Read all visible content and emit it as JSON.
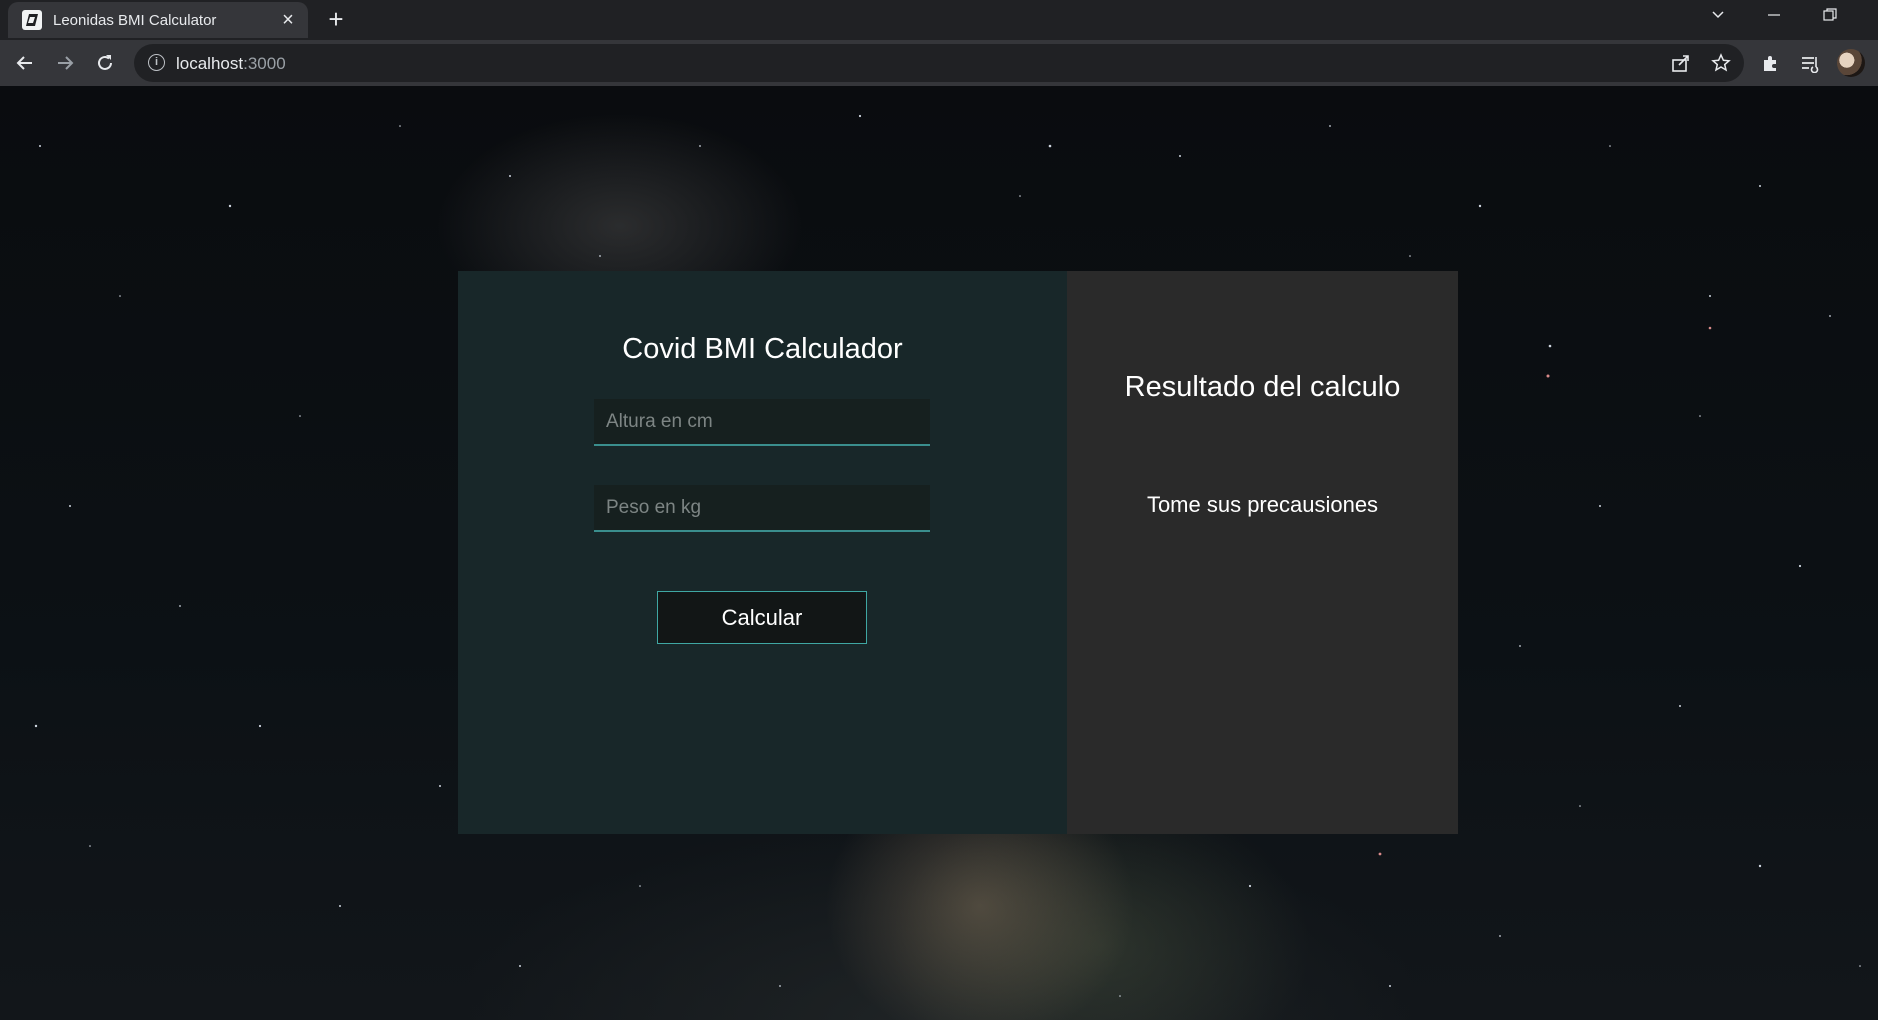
{
  "browser": {
    "tab": {
      "title": "Leonidas BMI Calculator",
      "favicon": "page-favicon-icon"
    },
    "new_tab_label": "+",
    "address": {
      "host": "localhost",
      "port": ":3000"
    },
    "icons": [
      "back-icon",
      "forward-icon",
      "reload-icon",
      "site-info-icon",
      "share-icon",
      "bookmark-star-icon",
      "extensions-icon",
      "reading-list-icon",
      "profile-avatar"
    ]
  },
  "calculator": {
    "title": "Covid BMI Calculador",
    "height_field": {
      "placeholder": "Altura en cm",
      "value": ""
    },
    "weight_field": {
      "placeholder": "Peso en kg",
      "value": ""
    },
    "submit_label": "Calcular"
  },
  "result": {
    "title": "Resultado del calculo",
    "message": "Tome sus precausiones"
  },
  "colors": {
    "left_panel": "#182729",
    "right_panel": "#2a2a2a",
    "accent": "#3fa7a3",
    "browser_tabbar": "#202124",
    "browser_toolbar": "#35363a"
  }
}
